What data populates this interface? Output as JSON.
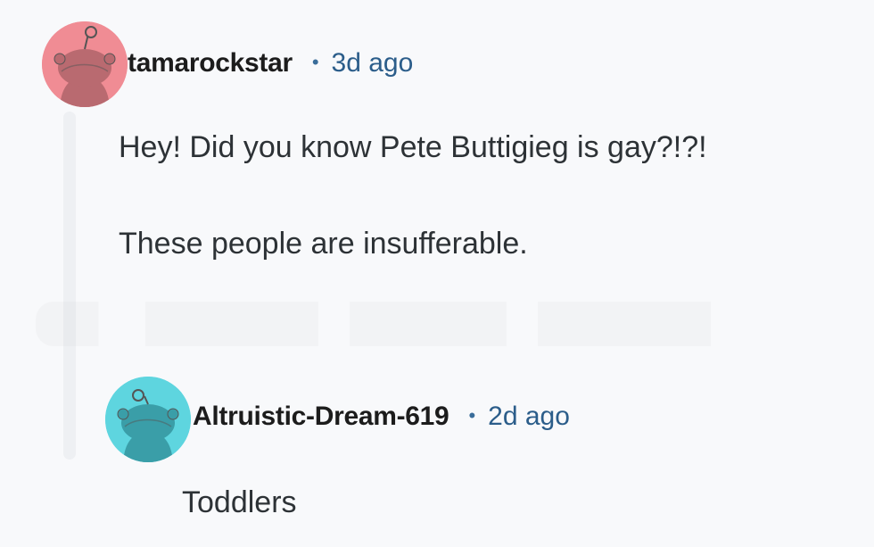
{
  "comments": [
    {
      "username": "tamarockstar",
      "separator": "•",
      "time": "3d ago",
      "avatar_color": "#f08c94",
      "avatar_icon": "snoo-avatar-icon",
      "paragraphs": [
        "Hey! Did you know Pete Buttigieg is gay?!?!",
        "These people are insufferable."
      ]
    },
    {
      "username": "Altruistic-Dream-619",
      "separator": "•",
      "time": "2d ago",
      "avatar_color": "#5ed5df",
      "avatar_icon": "snoo-avatar-icon",
      "paragraphs": [
        "Toddlers"
      ]
    }
  ],
  "colors": {
    "background": "#f8f9fb",
    "username": "#1c1c1c",
    "timestamp": "#2b5d8a",
    "body": "#2d3236"
  }
}
